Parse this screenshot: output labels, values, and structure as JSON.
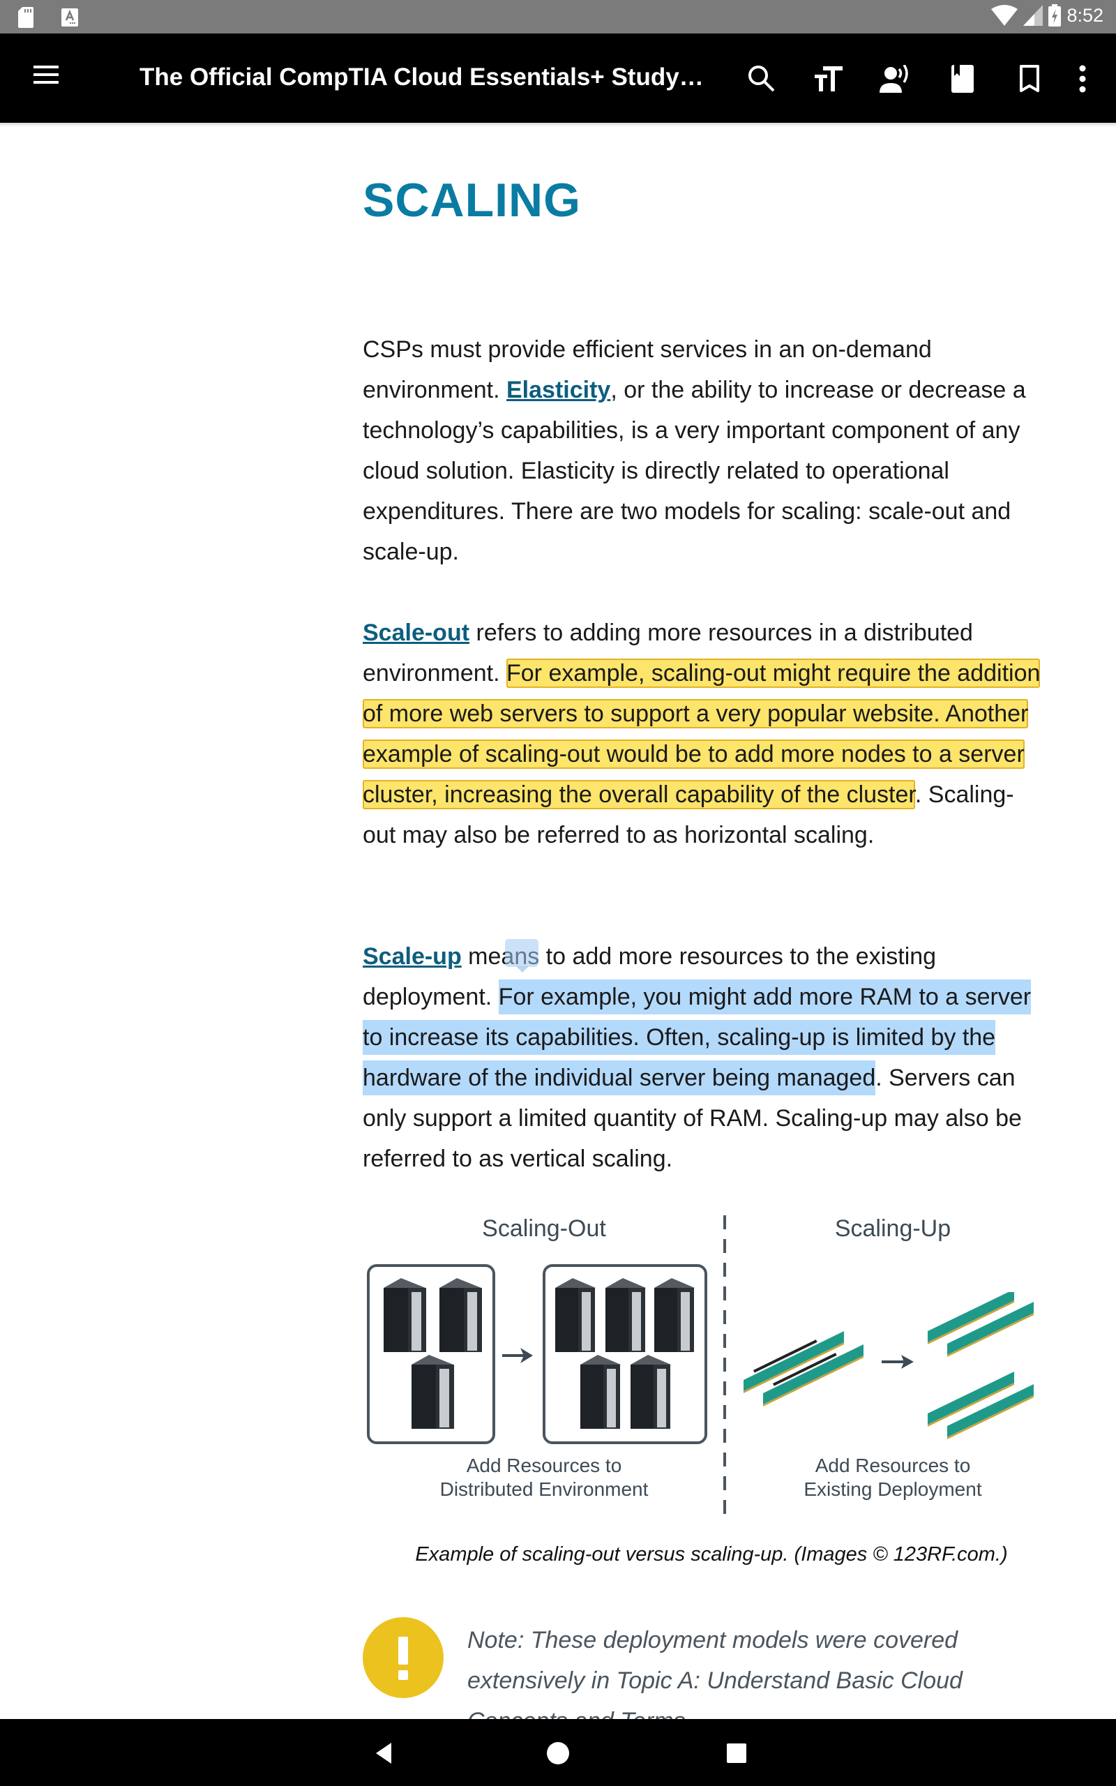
{
  "status_bar": {
    "time": "8:52",
    "left_icons": [
      "sd-card-icon",
      "text-a-icon"
    ],
    "right_icons": [
      "wifi-icon",
      "cell-signal-icon",
      "battery-charging-icon"
    ]
  },
  "app_bar": {
    "title": "The Official CompTIA Cloud Essentials+ Study ...",
    "actions": [
      {
        "name": "search",
        "icon": "search-icon"
      },
      {
        "name": "text-size",
        "icon": "text-size-icon"
      },
      {
        "name": "read-aloud",
        "icon": "read-aloud-icon"
      },
      {
        "name": "bookmarks-list",
        "icon": "book-bookmark-icon"
      },
      {
        "name": "bookmark",
        "icon": "bookmark-icon"
      },
      {
        "name": "more",
        "icon": "more-vert-icon"
      }
    ]
  },
  "content": {
    "heading": "SCALING",
    "para1": {
      "before_link": "CSPs must provide efficient services in an on-demand environment. ",
      "link": "Elasticity",
      "after_link": ", or the ability to increase or decrease a technology’s capabilities, is a very important component of any cloud solution. Elasticity is directly related to operational expenditures. There are two models for scaling: scale-out and scale-up."
    },
    "para2": {
      "link": "Scale-out",
      "text1": " refers to adding more resources in a distributed environment. ",
      "highlight": "For example, scaling-out might require the addition of more web servers to support a very popular website. Another example of scaling-out would be to add more nodes to a server cluster, increasing the overall capability of the cluster",
      "text2": ". Scaling-out may also be referred to as horizontal scaling."
    },
    "para3": {
      "link": "Scale-up",
      "text1a": " me",
      "text1b": "ans",
      "text1c": " to add more resources to the existing deployment. ",
      "selection": "For example, you might add more RAM to a server to increase its capabilities. Often, scaling-up is limited by the hardware of the individual server being managed",
      "text2": ". Servers can only support a limited quantity of RAM. Scaling-up may also be referred to as vertical scaling."
    },
    "figure": {
      "left_title": "Scaling-Out",
      "left_caption_line1": "Add Resources to",
      "left_caption_line2": "Distributed Environment",
      "right_title": "Scaling-Up",
      "right_caption_line1": "Add Resources to",
      "right_caption_line2": "Existing Deployment",
      "before_servers": 3,
      "after_servers": 5,
      "before_ram_modules": 2,
      "after_ram_modules": 4
    },
    "caption": "Example of scaling-out versus scaling-up. (Images © 123RF.com.)",
    "note": "Note: These deployment models were covered extensively in Topic A: Understand Basic Cloud Concepts and Terms."
  },
  "colors": {
    "heading": "#0a7ca3",
    "link": "#0d5e7e",
    "highlight_yellow": "#fde46a",
    "selection_blue": "#b3d9fb",
    "note_icon": "#ecc21f",
    "ram_green": "#1f9a8a"
  }
}
